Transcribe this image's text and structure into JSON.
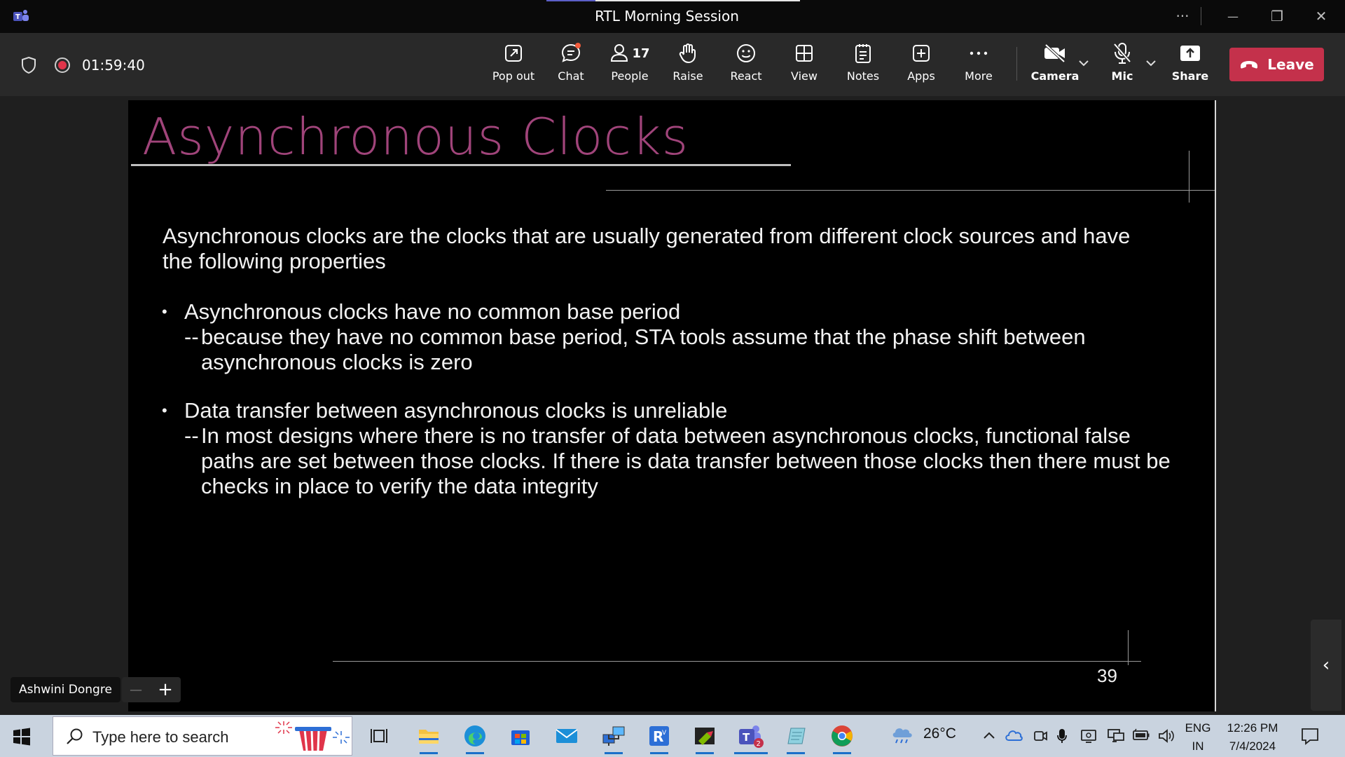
{
  "window": {
    "title": "RTL Morning Session",
    "more_glyph": "···",
    "minimize_glyph": "—",
    "restore_glyph": "❐",
    "close_glyph": "✕"
  },
  "meeting": {
    "elapsed": "01:59:40",
    "people_count": "17",
    "buttons": [
      {
        "label": "Pop out",
        "icon": "pop-out-icon"
      },
      {
        "label": "Chat",
        "icon": "chat-icon"
      },
      {
        "label": "People",
        "icon": "people-icon"
      },
      {
        "label": "Raise",
        "icon": "raise-hand-icon"
      },
      {
        "label": "React",
        "icon": "smiley-icon"
      },
      {
        "label": "View",
        "icon": "grid-view-icon"
      },
      {
        "label": "Notes",
        "icon": "notes-icon"
      },
      {
        "label": "Apps",
        "icon": "add-app-icon"
      },
      {
        "label": "More",
        "icon": "more-dots-icon"
      },
      {
        "label": "Camera",
        "icon": "camera-off-icon"
      },
      {
        "label": "Mic",
        "icon": "mic-off-icon"
      },
      {
        "label": "Share",
        "icon": "share-icon"
      }
    ],
    "leave_label": "Leave",
    "leave_color": "#c4314b",
    "recording_color": "#e0354a"
  },
  "slide": {
    "title": "Asynchronous Clocks",
    "title_color": "#a0447a",
    "intro": "Asynchronous clocks are the clocks that are usually generated from different clock sources and have the following properties",
    "bullets": [
      {
        "heading": "Asynchronous clocks have no common base period",
        "detail": "because they have no common base period, STA tools assume that the phase shift between asynchronous clocks is zero"
      },
      {
        "heading": "Data transfer between asynchronous clocks is unreliable",
        "detail": "In most designs where there is no transfer of data between  asynchronous clocks, functional false paths are set between those clocks. If there is data transfer between those clocks then there must be checks in place to verify the data integrity"
      }
    ],
    "dash": "--",
    "bullet_glyph": "•",
    "page_number": "39"
  },
  "presenter": {
    "name": "Ashwini Dongre"
  },
  "zoom": {
    "minus": "—",
    "plus": "+"
  },
  "panel_toggle_glyph": "‹",
  "taskbar": {
    "search_placeholder": "Type here to search",
    "weather_temp": "26°C",
    "language_line1": "ENG",
    "language_line2": "IN",
    "time": "12:26 PM",
    "date": "7/4/2024",
    "teams_badge": "2",
    "tray_chevron": "^"
  }
}
